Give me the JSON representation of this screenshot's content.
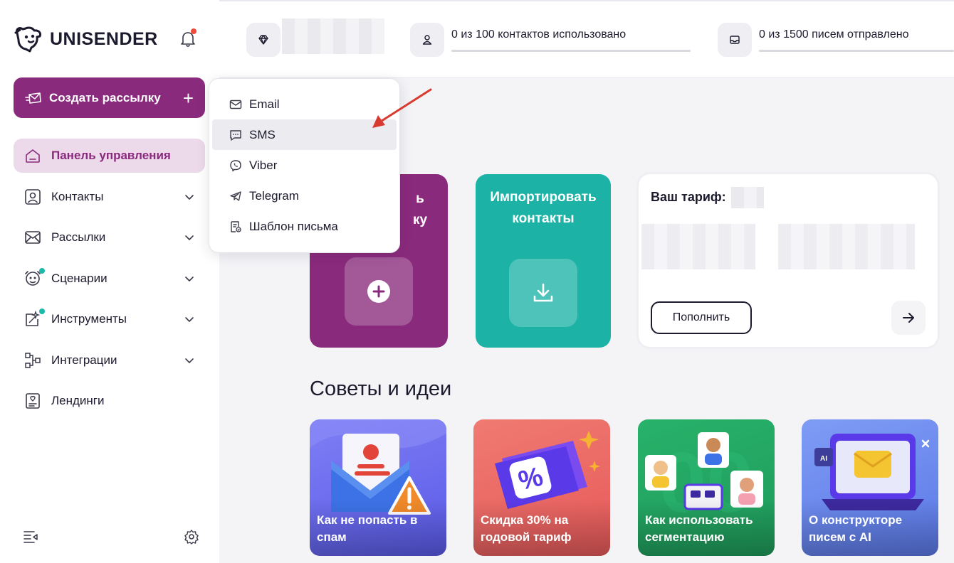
{
  "brand": {
    "name": "UNISENDER"
  },
  "sidebar": {
    "create_label": "Создать рассылку",
    "create_plus": "+",
    "items": [
      {
        "label": "Панель управления",
        "icon": "home-icon",
        "active": true,
        "chevron": false
      },
      {
        "label": "Контакты",
        "icon": "contacts-icon",
        "active": false,
        "chevron": true
      },
      {
        "label": "Рассылки",
        "icon": "mail-icon",
        "active": false,
        "chevron": true
      },
      {
        "label": "Сценарии",
        "icon": "scenario-icon",
        "active": false,
        "chevron": true,
        "dot": true
      },
      {
        "label": "Инструменты",
        "icon": "tools-icon",
        "active": false,
        "chevron": true,
        "dot": true
      },
      {
        "label": "Интеграции",
        "icon": "integrations-icon",
        "active": false,
        "chevron": true
      },
      {
        "label": "Лендинги",
        "icon": "landing-icon",
        "active": false,
        "chevron": false
      }
    ]
  },
  "header": {
    "contacts_stat": "0 из 100 контактов использовано",
    "emails_stat": "0 из 1500 писем отправлено"
  },
  "dropdown": {
    "items": [
      {
        "label": "Email",
        "icon": "envelope-icon"
      },
      {
        "label": "SMS",
        "icon": "sms-icon",
        "hover": true
      },
      {
        "label": "Viber",
        "icon": "viber-icon"
      },
      {
        "label": "Telegram",
        "icon": "telegram-icon"
      },
      {
        "label": "Шаблон письма",
        "icon": "template-icon"
      }
    ]
  },
  "cards": {
    "create_partial_line1": "ь",
    "create_partial_line2": "ку",
    "import_line1": "Импортировать",
    "import_line2": "контакты"
  },
  "tariff": {
    "title": "Ваш тариф:",
    "topup_label": "Пополнить"
  },
  "tips": {
    "title": "Советы и идеи",
    "items": [
      {
        "line1": "Как не попасть в",
        "line2": "спам"
      },
      {
        "line1": "Скидка 30% на",
        "line2": "годовой тариф"
      },
      {
        "line1": "Как использовать",
        "line2": "сегментацию"
      },
      {
        "line1": "О конструкторе",
        "line2": "писем с AI"
      }
    ]
  },
  "colors": {
    "brand_purple": "#8a2a7c",
    "teal": "#1cb3a6",
    "active_bg": "#ecd9ea",
    "notification_red": "#ef4a3c"
  }
}
